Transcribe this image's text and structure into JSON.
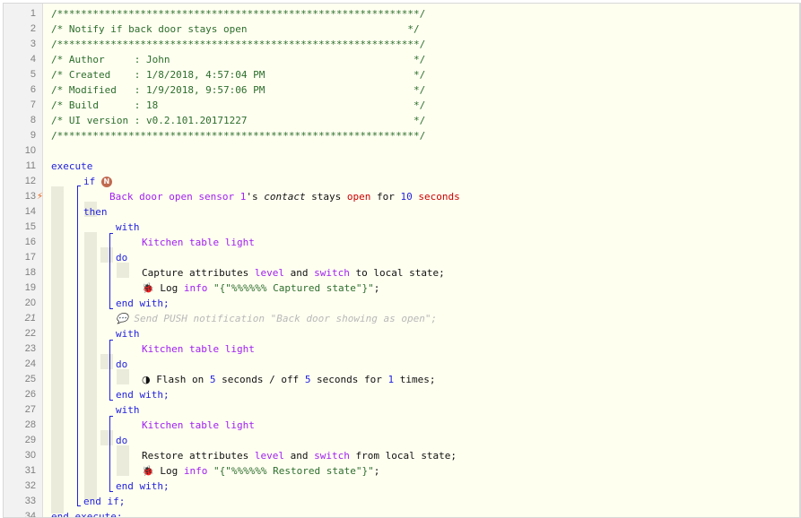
{
  "lines": [
    {
      "n": "1",
      "t": "/*************************************************************/"
    },
    {
      "n": "2",
      "t": "/* Notify if back door stays open                           */"
    },
    {
      "n": "3",
      "t": "/*************************************************************/"
    },
    {
      "n": "4",
      "t": "/* Author     : John                                         */"
    },
    {
      "n": "5",
      "t": "/* Created    : 1/8/2018, 4:57:04 PM                         */"
    },
    {
      "n": "6",
      "t": "/* Modified   : 1/9/2018, 9:57:06 PM                         */"
    },
    {
      "n": "7",
      "t": "/* Build      : 18                                           */"
    },
    {
      "n": "8",
      "t": "/* UI version : v0.2.101.20171227                            */"
    },
    {
      "n": "9",
      "t": "/*************************************************************/"
    },
    {
      "n": "10"
    },
    {
      "n": "11",
      "kw": "execute"
    },
    {
      "n": "12",
      "kw": "if",
      "badge": "N"
    },
    {
      "n": "13",
      "dev": "Back door open sensor 1",
      "apos": "'s ",
      "attr": "contact",
      "op": " stays ",
      "val": "open",
      "for": " for ",
      "num": "10",
      "unit": " seconds"
    },
    {
      "n": "14",
      "kw": "then"
    },
    {
      "n": "15",
      "kw": "with"
    },
    {
      "n": "16",
      "dev": "Kitchen table light"
    },
    {
      "n": "17",
      "kw": "do"
    },
    {
      "n": "18",
      "a": "Capture attributes ",
      "b": "level",
      "c": " and ",
      "d": "switch",
      "e": " to local state;"
    },
    {
      "n": "19",
      "icon": "🐞",
      "a": " Log ",
      "b": "info",
      "s": " \"{\"%%%%%% Captured state\"}\"",
      "e": ";"
    },
    {
      "n": "20",
      "kw": "end with;"
    },
    {
      "n": "21",
      "comment": "💬 Send PUSH notification \"Back door showing as open\";"
    },
    {
      "n": "22",
      "kw": "with"
    },
    {
      "n": "23",
      "dev": "Kitchen table light"
    },
    {
      "n": "24",
      "kw": "do"
    },
    {
      "n": "25",
      "icon": "◑",
      "a": " Flash on ",
      "n1": "5",
      "b": " seconds / off ",
      "n2": "5",
      "c": " seconds for ",
      "n3": "1",
      "e": " times;"
    },
    {
      "n": "26",
      "kw": "end with;"
    },
    {
      "n": "27",
      "kw": "with"
    },
    {
      "n": "28",
      "dev": "Kitchen table light"
    },
    {
      "n": "29",
      "kw": "do"
    },
    {
      "n": "30",
      "a": "Restore attributes ",
      "b": "level",
      "c": " and ",
      "d": "switch",
      "e": " from local state;"
    },
    {
      "n": "31",
      "icon": "🐞",
      "a": " Log ",
      "b": "info",
      "s": " \"{\"%%%%%% Restored state\"}\"",
      "e": ";"
    },
    {
      "n": "32",
      "kw": "end with;"
    },
    {
      "n": "33",
      "kw": "end if;"
    },
    {
      "n": "34",
      "kw": "end execute;"
    }
  ],
  "colors": {
    "keyword": "#2222dd",
    "device": "#a020f0",
    "comment": "#2c6e2c",
    "value": "#cc0000",
    "line_number": "#808080",
    "background": "#fffff0"
  },
  "icons": {
    "bolt_line_13": "lightning-bolt-icon",
    "log": "bug-icon",
    "flash": "half-circle-icon",
    "comment": "speech-bubble-icon"
  }
}
